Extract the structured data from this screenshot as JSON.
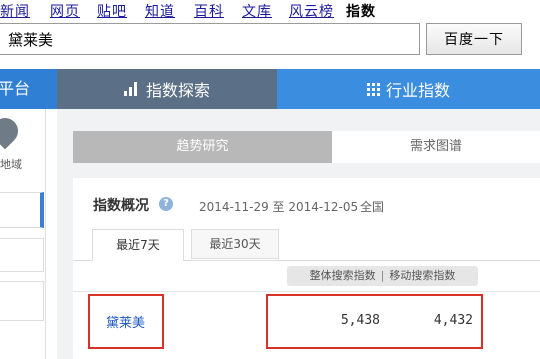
{
  "topnav": {
    "links": [
      "新闻",
      "网页",
      "贴吧",
      "知道",
      "百科",
      "文库",
      "风云榜"
    ],
    "current": "指数"
  },
  "search": {
    "value": "黛莱美",
    "button_label": "百度一下"
  },
  "bar": {
    "platform_label": "平台",
    "tab_explore_label": "指数探索",
    "tab_industry_label": "行业指数"
  },
  "sidebar": {
    "region_label": "地域"
  },
  "subtabs": {
    "trend_label": "趋势研究",
    "demand_label": "需求图谱"
  },
  "overview": {
    "title": "指数概况",
    "help_glyph": "?",
    "date_range": "2014-11-29 至 2014-12-05",
    "scope": "全国"
  },
  "period_tabs": {
    "tab_7": "最近7天",
    "tab_30": "最近30天"
  },
  "columns": {
    "overall": "整体搜索指数",
    "separator": "|",
    "mobile": "移动搜索指数"
  },
  "row": {
    "keyword": "黛莱美",
    "overall_value": "5,438",
    "mobile_value": "4,432"
  },
  "colors": {
    "blue_bar": "#3b8de0",
    "active_tab": "#5b6f86",
    "highlight_border": "#d9302a",
    "link": "#1f59c4"
  }
}
